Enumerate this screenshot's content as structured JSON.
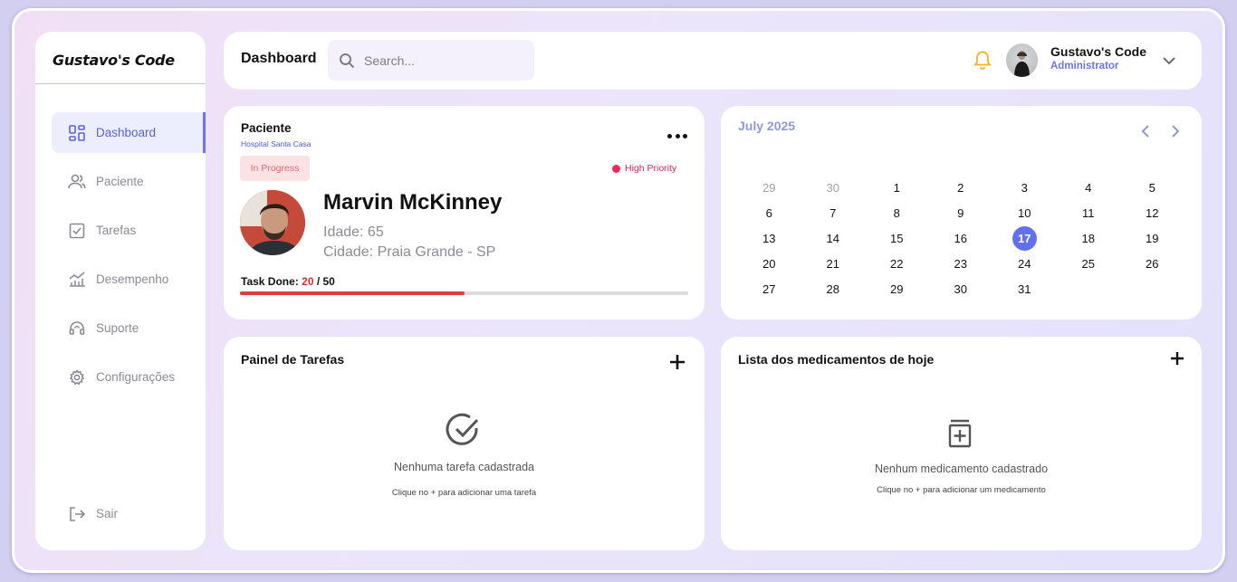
{
  "brand": "Gustavo's Code",
  "sidebar": {
    "items": [
      {
        "label": "Dashboard",
        "icon": "grid-icon"
      },
      {
        "label": "Paciente",
        "icon": "users-icon"
      },
      {
        "label": "Tarefas",
        "icon": "checkbox-icon"
      },
      {
        "label": "Desempenho",
        "icon": "chart-icon"
      },
      {
        "label": "Suporte",
        "icon": "headset-icon"
      },
      {
        "label": "Configurações",
        "icon": "gear-icon"
      }
    ],
    "logout": {
      "label": "Sair",
      "icon": "logout-icon"
    },
    "active_index": 0
  },
  "header": {
    "title": "Dashboard",
    "search_placeholder": "Search...",
    "user_name": "Gustavo's Code",
    "user_role": "Administrator"
  },
  "patient": {
    "title": "Paciente",
    "hospital": "Hospital Santa Casa",
    "status": "In Progress",
    "priority": "High Priority",
    "name": "Marvin McKinney",
    "age": "Idade: 65",
    "city": "Cidade: Praia Grande - SP",
    "task_label": "Task Done:",
    "task_done": "20",
    "task_total": "/ 50",
    "progress_fraction": 0.5,
    "colors": {
      "status_bg": "#fbe3e4",
      "priority": "#e0245a",
      "progress": "#e33b3b"
    }
  },
  "calendar": {
    "title": "July 2025",
    "weeks": [
      [
        {
          "d": "29",
          "m": true
        },
        {
          "d": "30",
          "m": true
        },
        {
          "d": "1"
        },
        {
          "d": "2"
        },
        {
          "d": "3"
        },
        {
          "d": "4"
        },
        {
          "d": "5"
        }
      ],
      [
        {
          "d": "6"
        },
        {
          "d": "7"
        },
        {
          "d": "8"
        },
        {
          "d": "9"
        },
        {
          "d": "10"
        },
        {
          "d": "11"
        },
        {
          "d": "12"
        }
      ],
      [
        {
          "d": "13"
        },
        {
          "d": "14"
        },
        {
          "d": "15"
        },
        {
          "d": "16"
        },
        {
          "d": "17",
          "today": true
        },
        {
          "d": "18"
        },
        {
          "d": "19"
        }
      ],
      [
        {
          "d": "20"
        },
        {
          "d": "21"
        },
        {
          "d": "22"
        },
        {
          "d": "23"
        },
        {
          "d": "24"
        },
        {
          "d": "25"
        },
        {
          "d": "26"
        }
      ],
      [
        {
          "d": "27"
        },
        {
          "d": "28"
        },
        {
          "d": "29"
        },
        {
          "d": "30"
        },
        {
          "d": "31"
        }
      ]
    ],
    "accent": "#6370ee"
  },
  "tasks_panel": {
    "title": "Painel de Tarefas",
    "empty_text": "Nenhuma tarefa cadastrada",
    "empty_hint": "Clique no + para adicionar uma tarefa"
  },
  "meds_panel": {
    "title": "Lista dos medicamentos de hoje",
    "empty_text": "Nenhum medicamento cadastrado",
    "empty_hint": "Clique no + para adicionar um medicamento"
  }
}
